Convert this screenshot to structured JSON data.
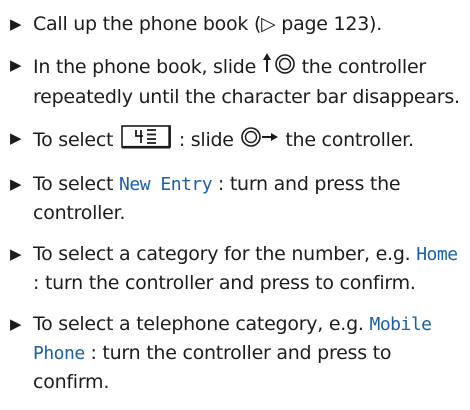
{
  "instructions": {
    "step1": {
      "bullet": "▶",
      "text": "Call up the phone book (▷ page 123)."
    },
    "step2": {
      "bullet": "▶",
      "before": "In the phone book, slide ",
      "controller_icon": "slide-up-controller-icon",
      "after": " the controller repeatedly until the character bar disappears."
    },
    "step3": {
      "bullet": "▶",
      "before": "To select ",
      "symbol_icon": "phonebook-options-symbol",
      "middle": ": slide ",
      "controller_icon": "slide-right-controller-icon",
      "after": " the controller."
    },
    "step4": {
      "bullet": "▶",
      "before": "To select ",
      "highlight": "New Entry",
      "after": ": turn and press the controller."
    },
    "step5": {
      "bullet": "▶",
      "before": "To select a category for the number, e.g. ",
      "highlight": "Home",
      "after": ": turn the controller and press to confirm."
    },
    "step6": {
      "bullet": "▶",
      "before": "To select a telephone category, e.g. ",
      "highlight": "Mobile Phone",
      "after": ": turn the controller and press to confirm."
    }
  },
  "colors": {
    "text": "#1c1c1c",
    "highlight": "#1a5fa8"
  }
}
